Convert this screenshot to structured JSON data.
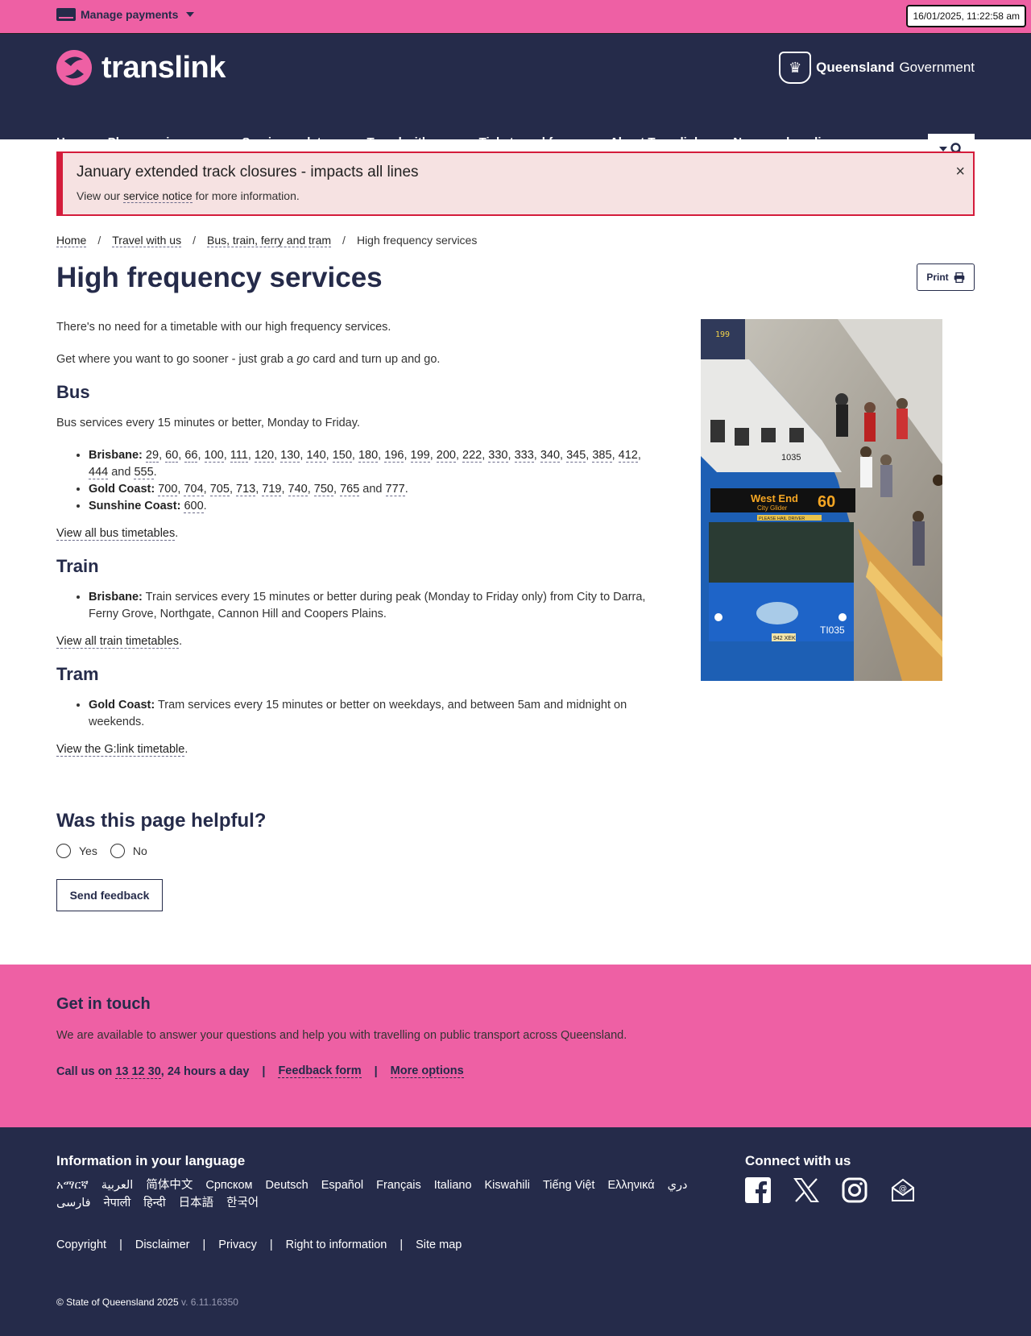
{
  "topbar": {
    "manage_payments": "Manage payments",
    "clock": "16/01/2025, 11:22:58 am"
  },
  "header": {
    "logo": "translink",
    "gov_bold": "Queensland",
    "gov_rest": " Government",
    "nav": [
      "Home",
      "Plan your journey",
      "Service updates",
      "Travel with us",
      "Tickets and fares",
      "About Translink",
      "News and media"
    ]
  },
  "alert": {
    "title": "January extended track closures - impacts all lines",
    "body_prefix": "View our ",
    "body_link": "service notice",
    "body_suffix": " for more information.",
    "close": "×"
  },
  "breadcrumb": {
    "items": [
      "Home",
      "Travel with us",
      "Bus, train, ferry and tram"
    ],
    "current": "High frequency services",
    "sep": "/"
  },
  "page": {
    "title": "High frequency services",
    "print_label": "Print",
    "intro1": "There's no need for a timetable with our high frequency services.",
    "intro2_prefix": "Get where you want to go sooner - just grab a ",
    "intro2_em": "go",
    "intro2_suffix": " card and turn up and go."
  },
  "bus": {
    "heading": "Bus",
    "desc": "Bus services every 15 minutes or better, Monday to Friday.",
    "brisbane_label": "Brisbane:",
    "brisbane_routes": [
      "29",
      "60",
      "66",
      "100",
      "111",
      "120",
      "130",
      "140",
      "150",
      "180",
      "196",
      "199",
      "200",
      "222",
      "330",
      "333",
      "340",
      "345",
      "385",
      "412",
      "444"
    ],
    "brisbane_last": "555",
    "gold_label": "Gold Coast:",
    "gold_routes": [
      "700",
      "704",
      "705",
      "713",
      "719",
      "740",
      "750",
      "765"
    ],
    "gold_last": "777",
    "sunshine_label": "Sunshine Coast:",
    "sunshine_routes": [
      "600"
    ],
    "view_link": "View all bus timetables"
  },
  "train": {
    "heading": "Train",
    "brisbane_label": "Brisbane:",
    "brisbane_text": "Train services every 15 minutes or better during peak (Monday to Friday only) from City to Darra, Ferny Grove, Northgate, Cannon Hill and Coopers Plains.",
    "view_link": "View all train timetables"
  },
  "tram": {
    "heading": "Tram",
    "gold_label": "Gold Coast:",
    "gold_text": "Tram services every 15 minutes or better on weekdays, and between 5am and midnight on weekends.",
    "view_link": "View the G:link timetable"
  },
  "photo": {
    "sign_dest": "West End",
    "sign_sub": "City Glider",
    "sign_route": "60",
    "fleet": "TI035",
    "roof_no": "1035",
    "plate": "942 XEK",
    "front_label": "PLEASE HAIL DRIVER"
  },
  "feedback": {
    "question": "Was this page helpful?",
    "yes": "Yes",
    "no": "No",
    "send": "Send feedback"
  },
  "contact": {
    "heading": "Get in touch",
    "desc": "We are available to answer your questions and help you with travelling on public transport across Queensland.",
    "call_prefix": "Call us on ",
    "phone": "13 12 30",
    "call_suffix": ", 24 hours a day",
    "feedback_form": "Feedback form",
    "more_options": "More options"
  },
  "footer": {
    "lang_heading": "Information in your language",
    "languages": [
      "አማርኛ",
      "العربية",
      "简体中文",
      "Српском",
      "Deutsch",
      "Español",
      "Français",
      "Italiano",
      "Kiswahili",
      "Tiếng Việt",
      "Ελληνικά",
      "دري",
      "فارسی",
      "नेपाली",
      "हिन्दी",
      "日本語",
      "한국어"
    ],
    "connect_heading": "Connect with us",
    "legal": [
      "Copyright",
      "Disclaimer",
      "Privacy",
      "Right to information",
      "Site map"
    ],
    "copyright": "© State of Queensland 2025",
    "version": "v. 6.11.16350"
  },
  "colors": {
    "pink": "#ee60a4",
    "navy": "#252b4a",
    "alert_red": "#d41c3b",
    "alert_bg": "#f6e2e2"
  }
}
